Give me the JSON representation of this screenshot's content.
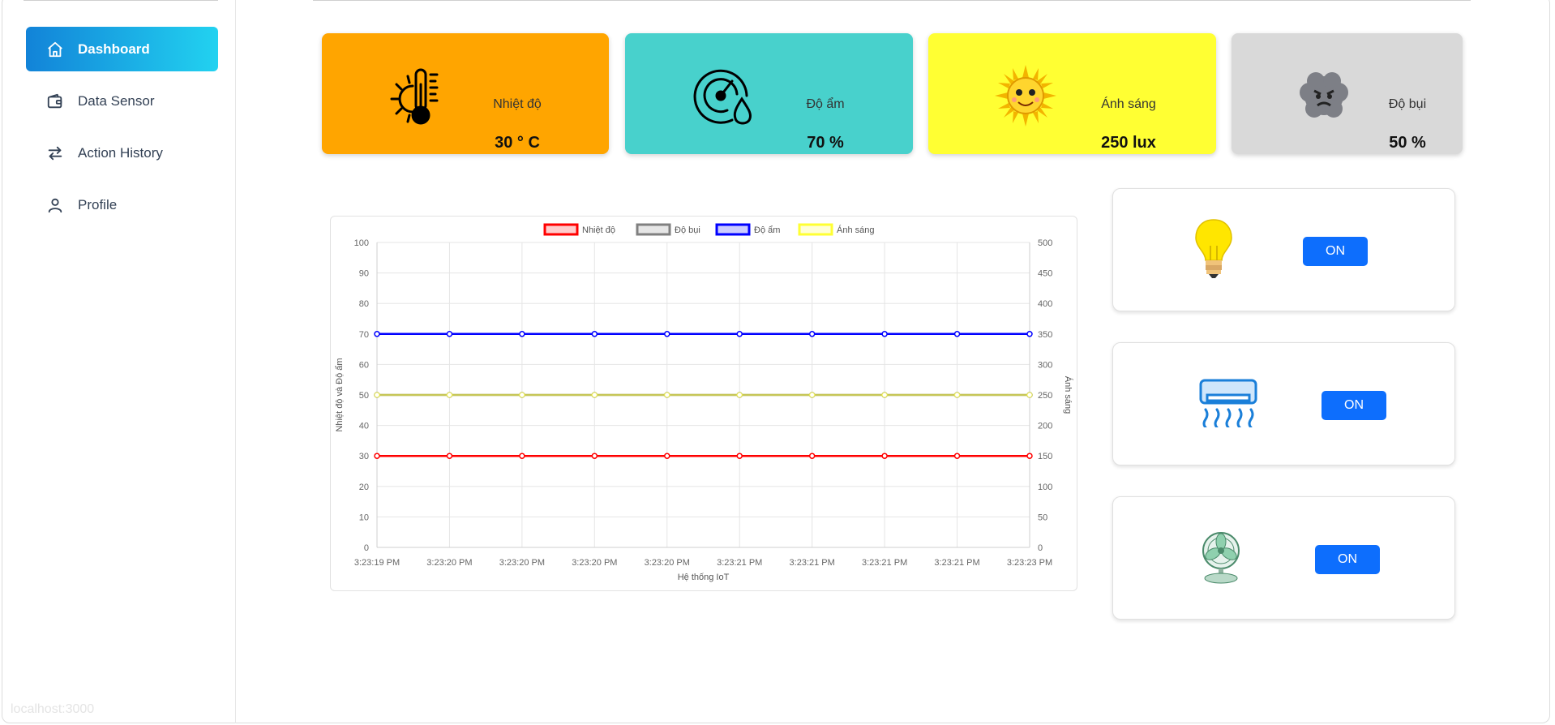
{
  "sidebar": {
    "items": [
      {
        "label": "Dashboard",
        "icon": "home-icon",
        "active": true
      },
      {
        "label": "Data Sensor",
        "icon": "wallet-icon",
        "active": false
      },
      {
        "label": "Action History",
        "icon": "swap-arrows-icon",
        "active": false
      },
      {
        "label": "Profile",
        "icon": "user-icon",
        "active": false
      }
    ],
    "host": "localhost:3000"
  },
  "cards": [
    {
      "label": "Nhiệt độ",
      "value": "30 ° C",
      "color": "#ffa500",
      "icon": "thermometer-sun-icon"
    },
    {
      "label": "Độ ẩm",
      "value": "70 %",
      "color": "#48d1cc",
      "icon": "humidity-gauge-icon"
    },
    {
      "label": "Ánh sáng",
      "value": "250 lux",
      "color": "#ffff33",
      "icon": "smiling-sun-icon"
    },
    {
      "label": "Độ bụi",
      "value": "50 %",
      "color": "#d9d9d9",
      "icon": "dust-cloud-icon"
    }
  ],
  "chart_data": {
    "type": "line",
    "x": [
      "3:23:19 PM",
      "3:23:20 PM",
      "3:23:20 PM",
      "3:23:20 PM",
      "3:23:20 PM",
      "3:23:21 PM",
      "3:23:21 PM",
      "3:23:21 PM",
      "3:23:21 PM",
      "3:23:23 PM"
    ],
    "xlabel": "Hệ thống IoT",
    "ylabel_left": "Nhiệt độ và Độ ẩm",
    "ylabel_right": "Ánh sáng",
    "ylim_left": [
      0,
      100
    ],
    "ylim_right": [
      0,
      500
    ],
    "yticks_left": [
      "0",
      "10",
      "20",
      "30",
      "40",
      "50",
      "60",
      "70",
      "80",
      "90",
      "100"
    ],
    "yticks_right": [
      "0",
      "50",
      "100",
      "150",
      "200",
      "250",
      "300",
      "350",
      "400",
      "450",
      "500"
    ],
    "grid": true,
    "legend_position": "top",
    "series": [
      {
        "name": "Nhiệt độ",
        "color": "#ff0000",
        "axis": "left",
        "values": [
          30,
          30,
          30,
          30,
          30,
          30,
          30,
          30,
          30,
          30
        ]
      },
      {
        "name": "Độ bụi",
        "color": "#808080",
        "axis": "left",
        "values": [
          50,
          50,
          50,
          50,
          50,
          50,
          50,
          50,
          50,
          50
        ]
      },
      {
        "name": "Độ ẩm",
        "color": "#0000ff",
        "axis": "left",
        "values": [
          70,
          70,
          70,
          70,
          70,
          70,
          70,
          70,
          70,
          70
        ]
      },
      {
        "name": "Ánh sáng",
        "color": "#ffff33",
        "axis": "right",
        "values": [
          250,
          250,
          250,
          250,
          250,
          250,
          250,
          250,
          250,
          250
        ]
      }
    ]
  },
  "devices": [
    {
      "icon": "light-bulb-icon",
      "button_label": "ON"
    },
    {
      "icon": "air-conditioner-icon",
      "button_label": "ON"
    },
    {
      "icon": "fan-icon",
      "button_label": "ON"
    }
  ]
}
